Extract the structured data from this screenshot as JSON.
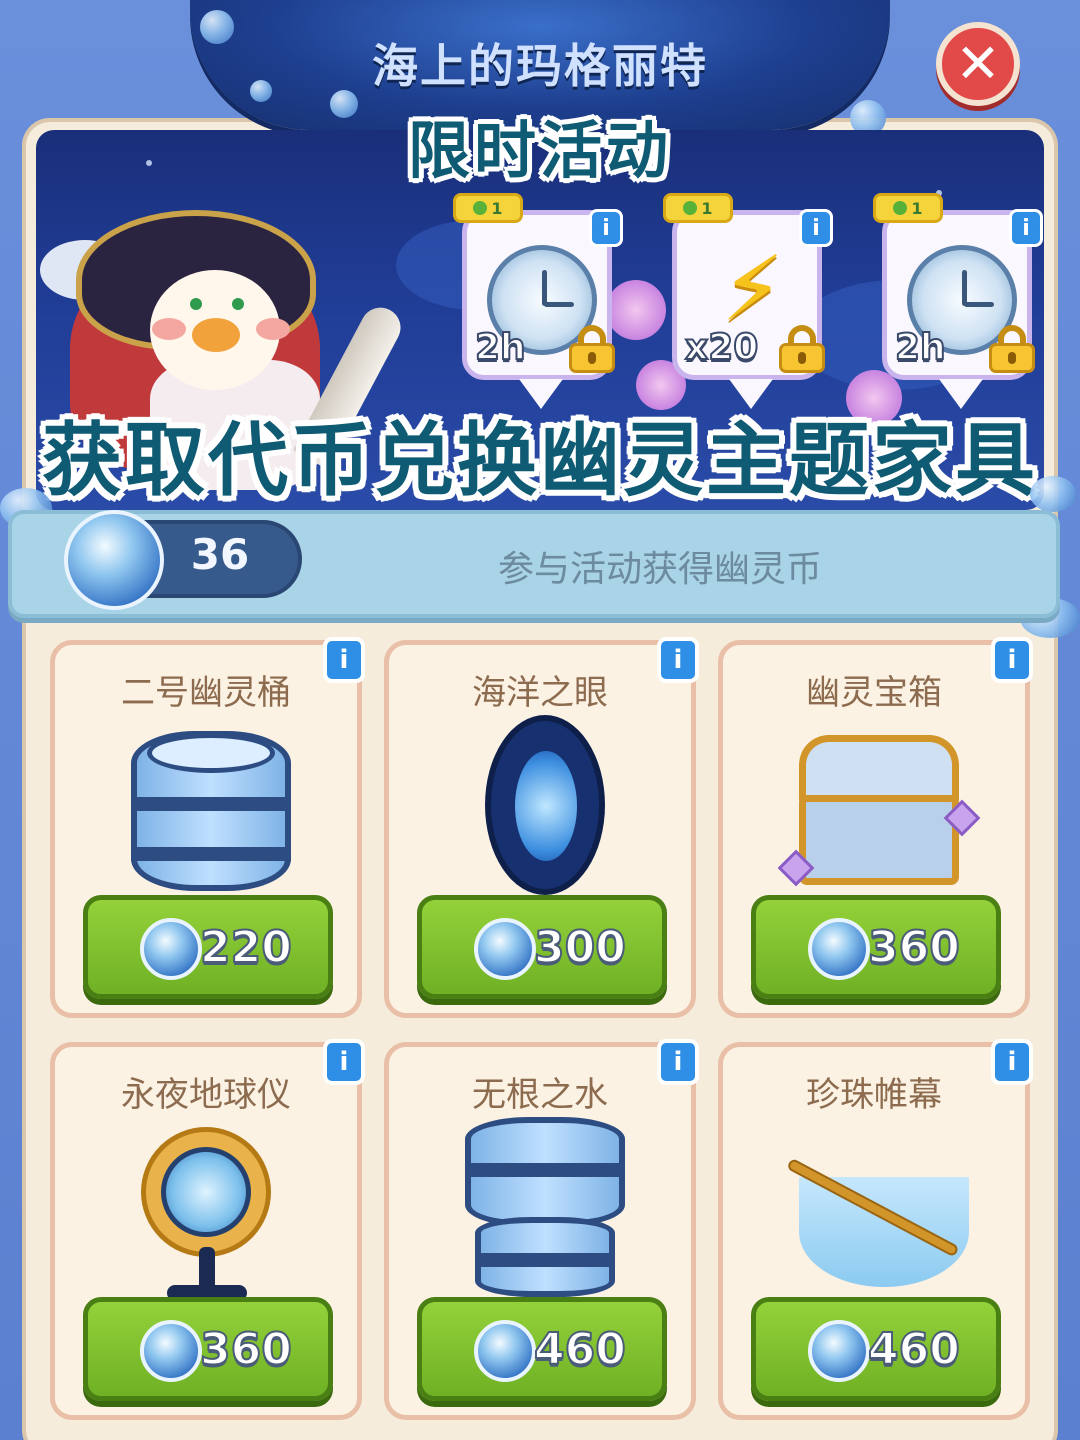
{
  "window": {
    "title": "海上的玛格丽特",
    "close_icon": "close-icon"
  },
  "captions": {
    "top": "限时活动",
    "middle": "获取代币兑换幽灵主题家具"
  },
  "rewards": [
    {
      "badge": "1",
      "icon": "clock-wing-icon",
      "amount": "2h",
      "locked": true
    },
    {
      "badge": "1",
      "icon": "lightning-icon",
      "amount": "x20",
      "locked": true
    },
    {
      "badge": "1",
      "icon": "clock-wing-icon",
      "amount": "2h",
      "locked": true
    }
  ],
  "currency": {
    "icon": "ghost-coin-icon",
    "count": "36",
    "hint": "参与活动获得幽灵币"
  },
  "shop": {
    "items": [
      {
        "name": "二号幽灵桶",
        "price": "220",
        "icon": "barrel-icon"
      },
      {
        "name": "海洋之眼",
        "price": "300",
        "icon": "mirror-icon"
      },
      {
        "name": "幽灵宝箱",
        "price": "360",
        "icon": "treasure-chest-icon"
      },
      {
        "name": "永夜地球仪",
        "price": "360",
        "icon": "globe-icon"
      },
      {
        "name": "无根之水",
        "price": "460",
        "icon": "water-barrel-icon"
      },
      {
        "name": "珍珠帷幕",
        "price": "460",
        "icon": "pearl-curtain-icon"
      }
    ]
  },
  "colors": {
    "accent_caption": "#0f5b73",
    "price_button": "#7fbf2c",
    "info_badge": "#2f8ee6",
    "close_button": "#e24a4a"
  }
}
